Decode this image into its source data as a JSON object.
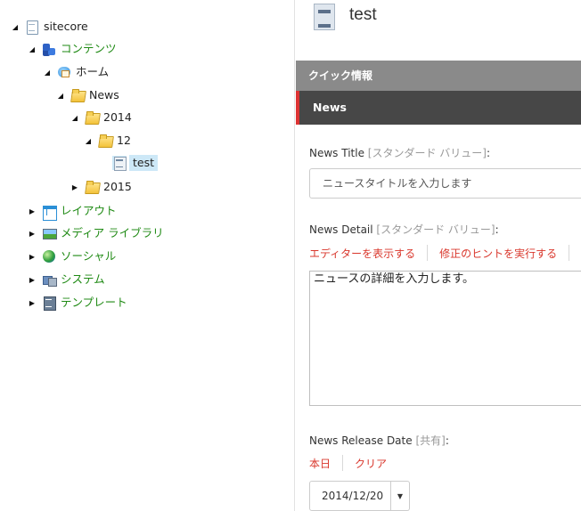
{
  "tree": {
    "root": {
      "label": "sitecore",
      "icon": "document-icon"
    },
    "content": {
      "label": "コンテンツ",
      "icon": "content-icon"
    },
    "home": {
      "label": "ホーム",
      "icon": "home-icon"
    },
    "news": {
      "label": "News",
      "icon": "folder-icon"
    },
    "y2014": {
      "label": "2014",
      "icon": "folder-icon"
    },
    "m12": {
      "label": "12",
      "icon": "folder-icon"
    },
    "test": {
      "label": "test",
      "icon": "page-icon"
    },
    "y2015": {
      "label": "2015",
      "icon": "folder-icon"
    },
    "layout": {
      "label": "レイアウト",
      "icon": "layout-icon"
    },
    "media": {
      "label": "メディア ライブラリ",
      "icon": "media-library-icon"
    },
    "social": {
      "label": "ソーシャル",
      "icon": "social-icon"
    },
    "system": {
      "label": "システム",
      "icon": "system-icon"
    },
    "templates": {
      "label": "テンプレート",
      "icon": "template-icon"
    }
  },
  "header": {
    "title": "test",
    "icon": "page-icon"
  },
  "quick_info": {
    "label": "クイック情報"
  },
  "section": {
    "label": "News"
  },
  "fields": {
    "news_title": {
      "label": "News Title",
      "hint": "[スタンダード バリュー]",
      "colon": ":",
      "value": "ニュースタイトルを入力します"
    },
    "news_detail": {
      "label": "News Detail",
      "hint": "[スタンダード バリュー]",
      "colon": ":",
      "show_editor": "エディターを表示する",
      "run_suggest": "修正のヒントを実行する",
      "value": "ニュースの詳細を入力します。"
    },
    "release_date": {
      "label": "News Release Date",
      "hint": "[共有]",
      "colon": ":",
      "today": "本日",
      "clear": "クリア",
      "value": "2014/12/20"
    }
  },
  "colors": {
    "accent_red": "#d9372c",
    "tree_green": "#1f8a14",
    "selection_blue": "#cde8f7",
    "quick_bar": "#8a8a8a",
    "section_bar": "#474747"
  }
}
